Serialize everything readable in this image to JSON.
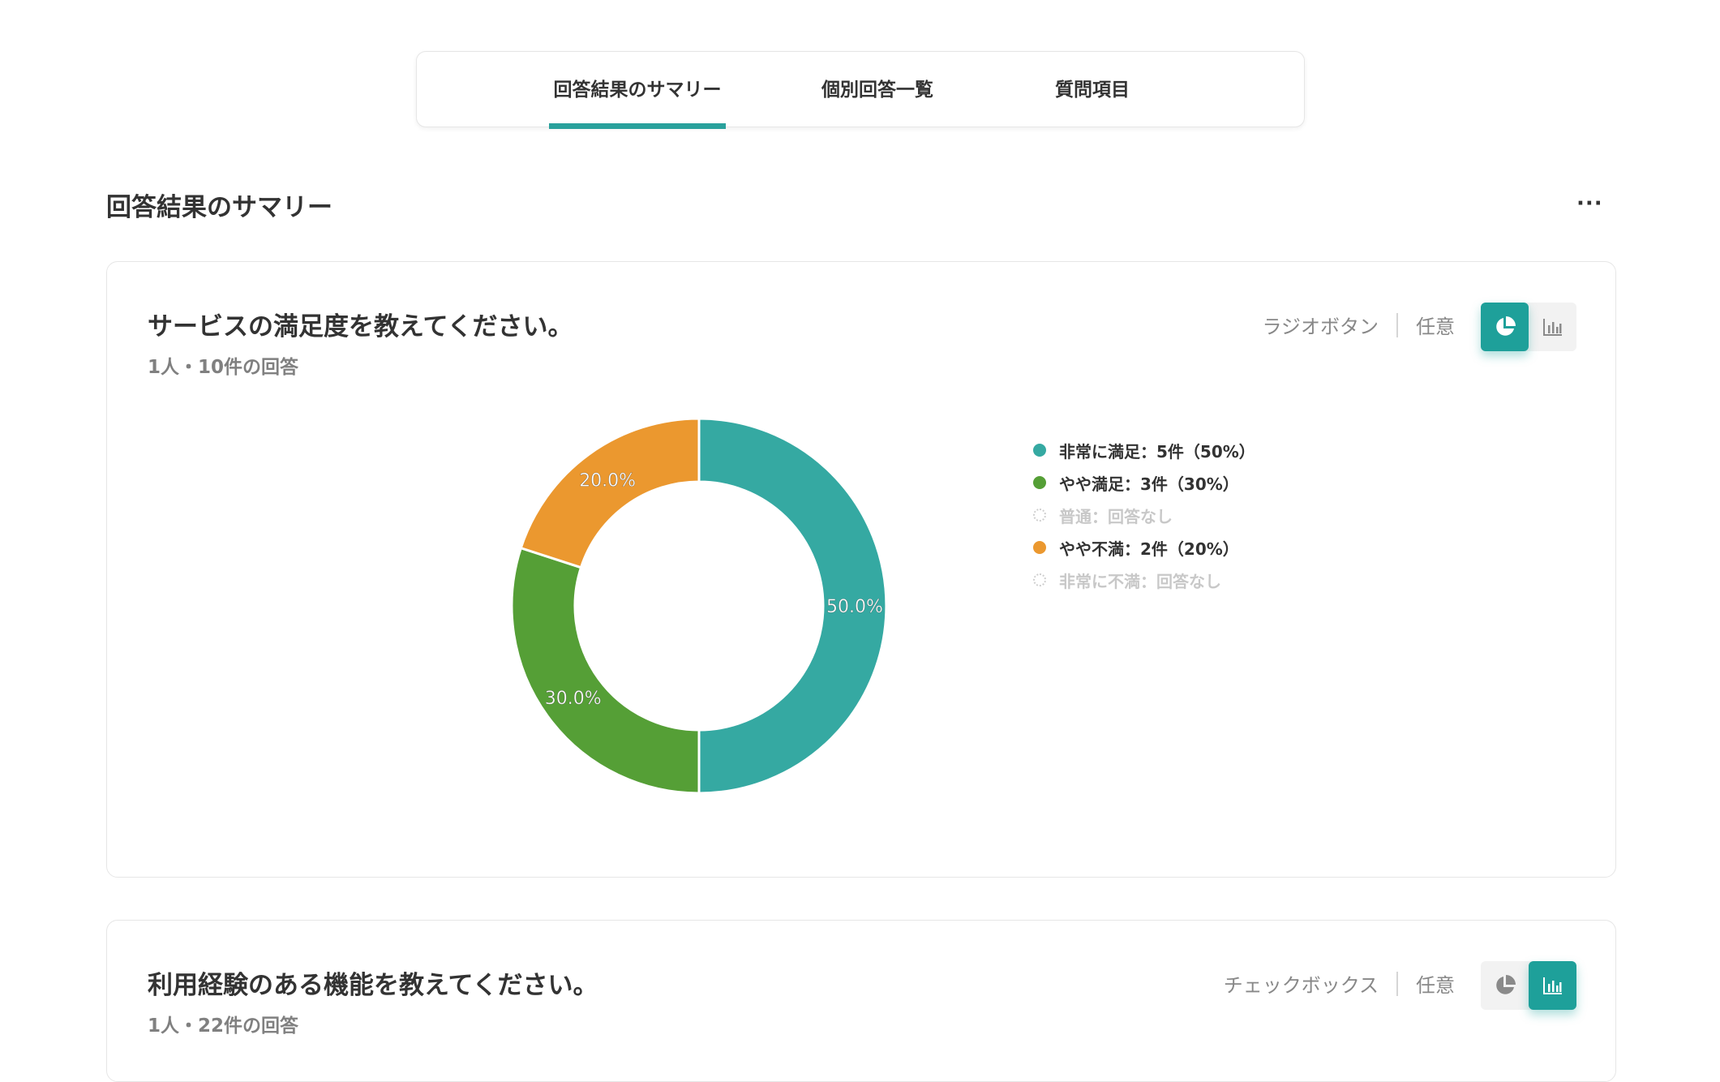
{
  "tabs": [
    {
      "label": "回答結果のサマリー",
      "active": true
    },
    {
      "label": "個別回答一覧",
      "active": false
    },
    {
      "label": "質問項目",
      "active": false
    }
  ],
  "section": {
    "title": "回答結果のサマリー",
    "more_label": "···"
  },
  "questions": [
    {
      "title": "サービスの満足度を教えてください。",
      "subtitle": "1人・10件の回答",
      "type_label": "ラジオボタン",
      "required_label": "任意",
      "view": "pie"
    },
    {
      "title": "利用経験のある機能を教えてください。",
      "subtitle": "1人・22件の回答",
      "type_label": "チェックボックス",
      "required_label": "任意",
      "view": "bar"
    }
  ],
  "chart_data": {
    "type": "pie",
    "donut": true,
    "slices": [
      {
        "label": "非常に満足",
        "count": 5,
        "percent": 50.0,
        "color": "#35a9a2",
        "legend": "非常に満足：5件（50%）",
        "data_label": "50.0%"
      },
      {
        "label": "やや満足",
        "count": 3,
        "percent": 30.0,
        "color": "#559f36",
        "legend": "やや満足：3件（30%）",
        "data_label": "30.0%"
      },
      {
        "label": "普通",
        "count": 0,
        "percent": 0,
        "color": "#cccccc",
        "legend": "普通：回答なし",
        "data_label": ""
      },
      {
        "label": "やや不満",
        "count": 2,
        "percent": 20.0,
        "color": "#eb982f",
        "legend": "やや不満：2件（20%）",
        "data_label": "20.0%"
      },
      {
        "label": "非常に不満",
        "count": 0,
        "percent": 0,
        "color": "#cccccc",
        "legend": "非常に不満：回答なし",
        "data_label": ""
      }
    ],
    "legend_position": "right"
  },
  "colors": {
    "accent": "#1ea09a",
    "border": "#e6e6e6"
  },
  "icons": {
    "pie_toggle": "pie-chart-icon",
    "bar_toggle": "bar-chart-icon"
  }
}
